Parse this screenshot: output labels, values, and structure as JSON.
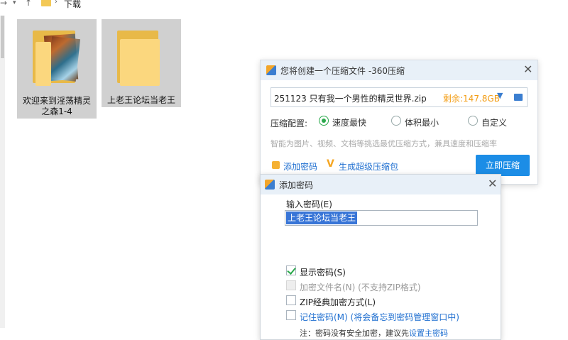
{
  "explorer": {
    "path": "下载",
    "folders": [
      {
        "name_line1": "欢迎来到淫荡精灵",
        "name_line2": "之森1-4"
      },
      {
        "name_line1": "上老王论坛当老王"
      }
    ]
  },
  "compress_dialog": {
    "title": "您将创建一个压缩文件 -360压缩",
    "filename": "251123 只有我一个男性的精灵世界.zip",
    "free_space": "剩余:147.8GB",
    "config_label": "压缩配置:",
    "options": [
      {
        "label": "速度最快",
        "selected": true
      },
      {
        "label": "体积最小",
        "selected": false
      },
      {
        "label": "自定义",
        "selected": false
      }
    ],
    "hint": "智能为图片、视频、文档等挑选最优压缩方式，兼具速度和压缩率",
    "add_password": "添加密码",
    "super_package": "生成超级压缩包",
    "compress_button": "立即压缩"
  },
  "password_dialog": {
    "title": "添加密码",
    "input_label": "输入密码(E)",
    "password_value": "上老王论坛当老王",
    "checkboxes": [
      {
        "label": "显示密码(S)",
        "checked": true,
        "disabled": false
      },
      {
        "label": "加密文件名(N) (不支持ZIP格式)",
        "checked": false,
        "disabled": true
      },
      {
        "label": "ZIP经典加密方式(L)",
        "checked": false,
        "disabled": false
      },
      {
        "label": "记住密码(M) (将会备忘到密码管理窗口中)",
        "checked": false,
        "disabled": false
      }
    ],
    "note_prefix": "注：密码没有安全加密，建议先",
    "note_link": "设置主密码"
  },
  "colors": {
    "accent": "#1c8de6",
    "green": "#2ba94c",
    "orange": "#f39c12",
    "link": "#1f6fd0"
  }
}
